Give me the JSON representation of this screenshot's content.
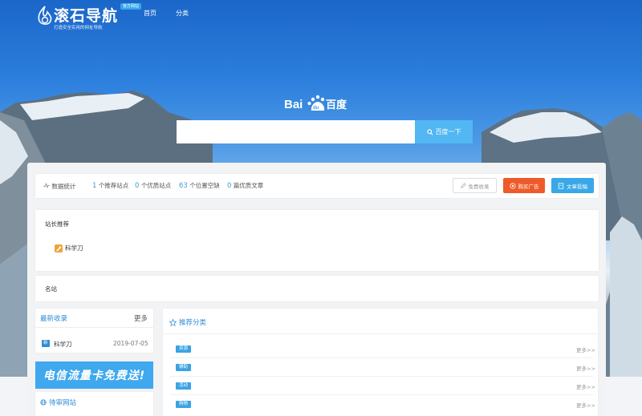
{
  "header": {
    "logo_title": "滚石导航",
    "logo_badge": "官方网站",
    "logo_subtitle": "打造安全实用的网址导航",
    "nav": [
      "首页",
      "分类"
    ]
  },
  "search": {
    "engine_name": "百度",
    "placeholder": "",
    "button_label": "百度一下"
  },
  "stats": {
    "label": "数据统计",
    "items": [
      {
        "value": "1",
        "text": "个推荐站点"
      },
      {
        "value": "0",
        "text": "个优质站点"
      },
      {
        "value": "63",
        "text": "个位置空缺"
      },
      {
        "value": "0",
        "text": "篇优质文章"
      }
    ],
    "buttons": {
      "collect": "免费收录",
      "ad": "购买广告",
      "post": "文章投稿"
    }
  },
  "recommend": {
    "title": "站长推荐",
    "sites": [
      "科学刀"
    ]
  },
  "famous": {
    "title": "名站"
  },
  "latest": {
    "title": "最新收录",
    "more": "更多",
    "items": [
      {
        "tag": "新",
        "name": "科学刀",
        "date": "2019-07-05"
      }
    ]
  },
  "banner": {
    "text": "电信流量卡免费送!"
  },
  "pending": {
    "title": "待审网站"
  },
  "categories": {
    "title": "推荐分类",
    "more_label": "更多>>",
    "items": [
      "资源",
      "辅助",
      "活动",
      "购物"
    ]
  },
  "colors": {
    "accent": "#2f8dd6",
    "ad_button": "#ef5a2b",
    "post_button": "#39a8e8",
    "search_button": "#52b7f3"
  }
}
